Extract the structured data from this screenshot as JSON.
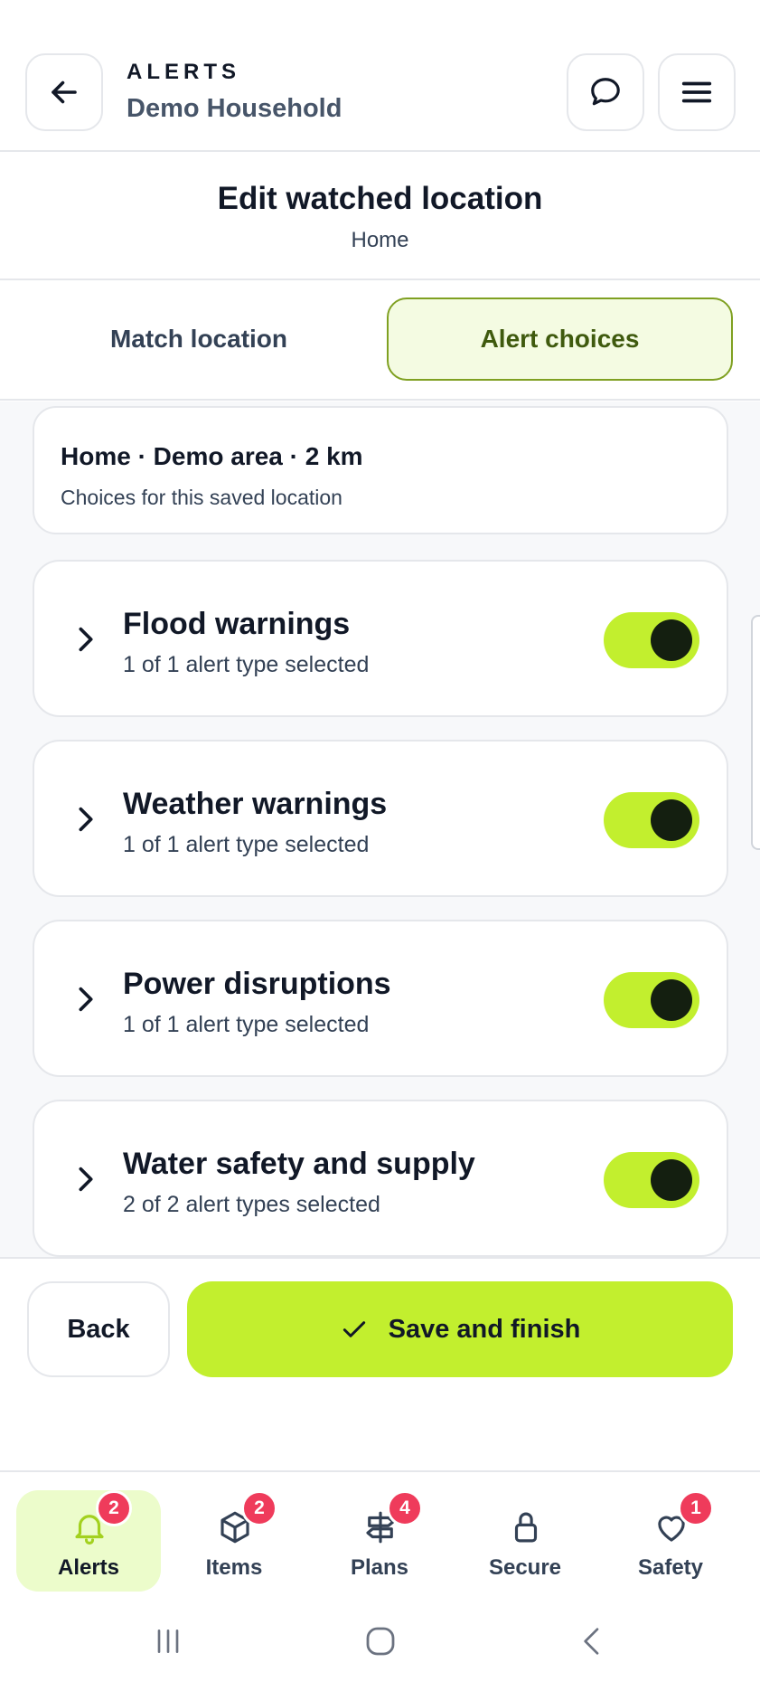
{
  "header": {
    "eyebrow": "ALERTS",
    "household": "Demo Household",
    "icons": {
      "back": "arrow-left-icon",
      "chat": "chat-bubble-icon",
      "menu": "hamburger-menu-icon"
    }
  },
  "title_block": {
    "title": "Edit watched location",
    "subtitle": "Home"
  },
  "tabs": [
    {
      "label": "Match location",
      "active": false
    },
    {
      "label": "Alert choices",
      "active": true
    }
  ],
  "summary": {
    "title": "Home · Demo area · 2 km",
    "subtitle": "Choices for this saved location"
  },
  "categories": [
    {
      "name": "Flood warnings",
      "count": "1 of 1 alert type selected",
      "enabled": true
    },
    {
      "name": "Weather warnings",
      "count": "1 of 1 alert type selected",
      "enabled": true
    },
    {
      "name": "Power disruptions",
      "count": "1 of 1 alert type selected",
      "enabled": true
    },
    {
      "name": "Water safety and supply",
      "count": "2 of 2 alert types selected",
      "enabled": true
    }
  ],
  "actions": {
    "back_label": "Back",
    "save_label": "Save and finish"
  },
  "bottom_nav": [
    {
      "label": "Alerts",
      "badge": "2",
      "icon": "bell-icon",
      "active": true
    },
    {
      "label": "Items",
      "badge": "2",
      "icon": "box-icon",
      "active": false
    },
    {
      "label": "Plans",
      "badge": "4",
      "icon": "signpost-icon",
      "active": false
    },
    {
      "label": "Secure",
      "badge": "",
      "icon": "lock-icon",
      "active": false
    },
    {
      "label": "Safety",
      "badge": "1",
      "icon": "heart-icon",
      "active": false
    }
  ],
  "colors": {
    "accent": "#c2ef2e",
    "accent_border": "#7fa021",
    "badge": "#ef3b5b",
    "text": "#111827"
  }
}
